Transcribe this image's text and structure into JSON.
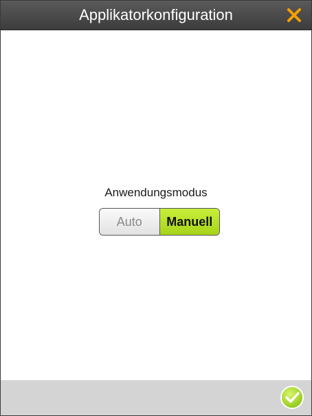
{
  "window": {
    "title": "Applikatorkonfiguration"
  },
  "icons": {
    "close": "close-icon",
    "confirm": "check-circle-icon"
  },
  "colors": {
    "titlebar": "#444444",
    "close_accent": "#f5a000",
    "selected_segment": "#b4e02a",
    "footer": "#d4d4d4",
    "confirm_accent": "#a6d41a"
  },
  "mode": {
    "label": "Anwendungsmodus",
    "options": [
      "Auto",
      "Manuell"
    ],
    "selected": "Manuell"
  }
}
